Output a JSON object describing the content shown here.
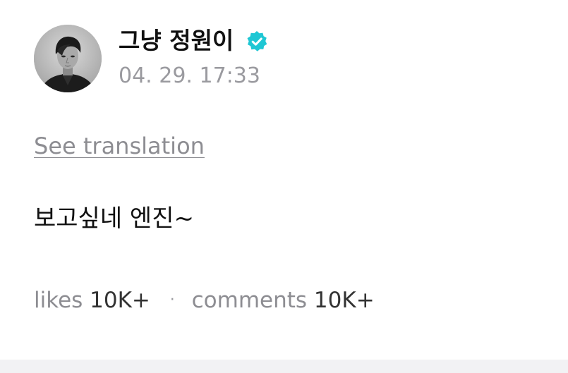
{
  "author": {
    "name": "그냥 정원이",
    "verified": true,
    "verified_icon": "verified-check-icon",
    "verified_color": "#1fc7d4",
    "avatar": "avatar-photo"
  },
  "post": {
    "timestamp": "04. 29. 17:33",
    "translate_label": "See translation",
    "body": "보고싶네 엔진~"
  },
  "stats": {
    "likes_label": "likes",
    "likes_value": "10K+",
    "separator": "·",
    "comments_label": "comments",
    "comments_value": "10K+"
  }
}
